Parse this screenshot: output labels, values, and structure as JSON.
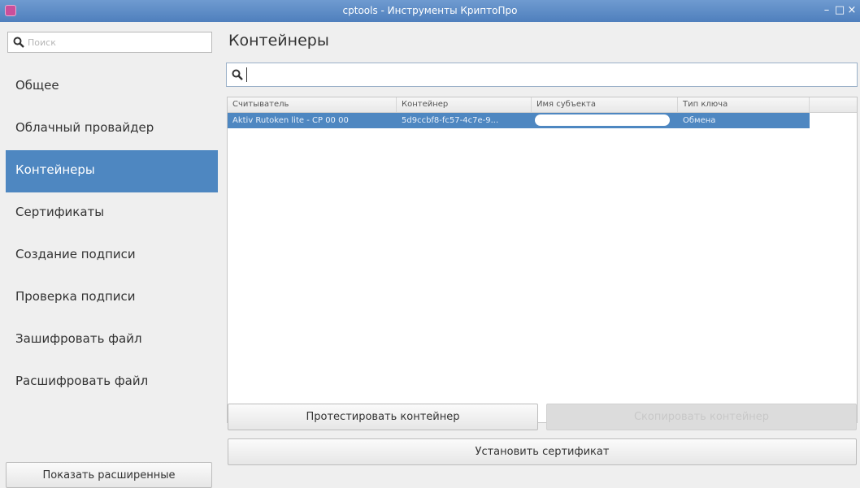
{
  "window": {
    "title": "cptools - Инструменты КриптоПро",
    "controls": {
      "minimize": "–",
      "maximize": "□",
      "close": "×"
    }
  },
  "sidebar": {
    "search_placeholder": "Поиск",
    "items": [
      {
        "label": "Общее",
        "active": false
      },
      {
        "label": "Облачный провайдер",
        "active": false
      },
      {
        "label": "Контейнеры",
        "active": true
      },
      {
        "label": "Сертификаты",
        "active": false
      },
      {
        "label": "Создание подписи",
        "active": false
      },
      {
        "label": "Проверка подписи",
        "active": false
      },
      {
        "label": "Зашифровать файл",
        "active": false
      },
      {
        "label": "Расшифровать файл",
        "active": false
      }
    ],
    "show_advanced_label": "Показать расширенные"
  },
  "main": {
    "title": "Контейнеры",
    "filter_value": "",
    "table": {
      "columns": [
        "Считыватель",
        "Контейнер",
        "Имя субъекта",
        "Тип ключа"
      ],
      "rows": [
        {
          "reader": "Aktiv Rutoken lite - CP 00 00",
          "container": "5d9ccbf8-fc57-4c7e-9...",
          "subject": "",
          "key_type": "Обмена",
          "selected": true
        }
      ]
    },
    "buttons": {
      "test": "Протестировать контейнер",
      "copy": "Скопировать контейнер",
      "install": "Установить сертификат"
    }
  },
  "icons": {
    "app": "cryptopro-app-icon",
    "search": "search-icon"
  },
  "colors": {
    "accent": "#4e87c1",
    "titlebar": "#5b88c4"
  }
}
